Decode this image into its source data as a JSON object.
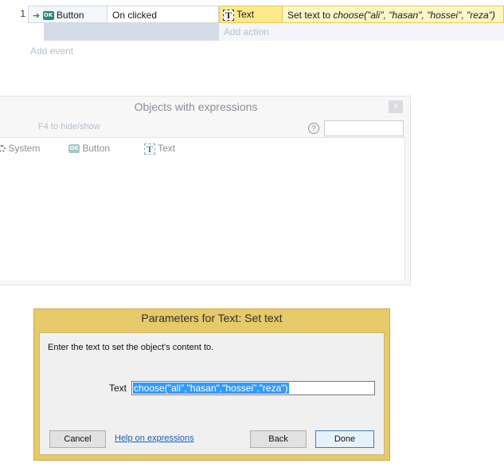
{
  "event": {
    "number": "1",
    "condition_object": "Button",
    "condition_text": "On clicked",
    "action_object": "Text",
    "action_prefix": "Set text to ",
    "action_expression": "choose(\"ali\", \"hasan\", \"hossei\", \"reza\")",
    "add_action": "Add action",
    "add_event": "Add event"
  },
  "panel": {
    "title": "Objects with expressions",
    "close_label": "x",
    "hint": "F4 to hide/show",
    "search_value": "",
    "items": [
      {
        "label": "System",
        "icon": "gear-icon"
      },
      {
        "label": "Button",
        "icon": "ok-button-icon"
      },
      {
        "label": "Text",
        "icon": "text-t-icon"
      }
    ]
  },
  "dialog": {
    "title": "Parameters for Text: Set text",
    "description": "Enter the text to set the object's content to.",
    "param_label": "Text",
    "param_value": "choose(\"ali\",\"hasan\",\"hossei\",\"reza\")",
    "cancel_label": "Cancel",
    "help_link": "Help on expressions",
    "back_label": "Back",
    "done_label": "Done"
  },
  "colors": {
    "dialog_frame": "#e6c968",
    "action_highlight": "#fde98c",
    "selection": "#3399ff"
  }
}
